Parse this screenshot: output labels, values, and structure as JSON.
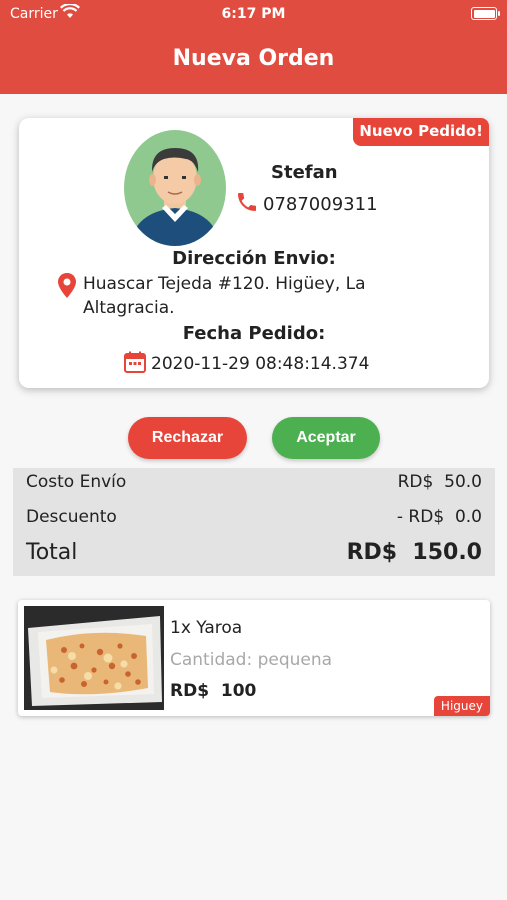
{
  "status_bar": {
    "carrier": "Carrier",
    "time": "6:17 PM"
  },
  "header": {
    "title": "Nueva Orden"
  },
  "order": {
    "badge": "Nuevo Pedido!",
    "customer_name": "Stefan",
    "phone": "0787009311",
    "address_title": "Dirección Envio:",
    "address": "Huascar Tejeda #120. Higüey, La Altagracia.",
    "date_title": "Fecha Pedido:",
    "date": "2020-11-29 08:48:14.374"
  },
  "actions": {
    "reject_label": "Rechazar",
    "accept_label": "Aceptar"
  },
  "summary": {
    "shipping_label": "Costo Envío",
    "shipping_value": "RD$  50.0",
    "discount_label": "Descuento",
    "discount_value": "- RD$  0.0",
    "total_label": "Total",
    "total_value": "RD$  150.0"
  },
  "items": [
    {
      "name": "1x Yaroa",
      "quantity": "Cantidad: pequena",
      "price": "RD$  100",
      "location": "Higuey"
    }
  ],
  "colors": {
    "header": "#e04d40",
    "reject": "#e8453a",
    "accept": "#4caf50",
    "badge": "#e8453a"
  }
}
